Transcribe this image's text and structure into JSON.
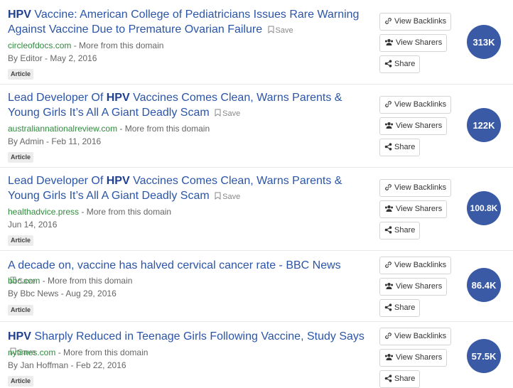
{
  "common": {
    "save_label": "Save",
    "more_label": "More from this domain",
    "separator": " - ",
    "view_backlinks": "View Backlinks",
    "view_sharers": "View Sharers",
    "share": "Share",
    "tag": "Article",
    "icons": [
      "bookmark-icon",
      "link-icon",
      "users-icon",
      "share-icon"
    ],
    "colors": {
      "title": "#2b55a8",
      "domain": "#2e8b3d",
      "circle": "#3a5aa6"
    }
  },
  "articles": [
    {
      "title_bold": "HPV",
      "title_rest": " Vaccine: American College of Pediatricians Issues Rare Warning Against Vaccine Due to Premature Ovarian Failure",
      "domain": "circleofdocs.com",
      "byline": "By Editor - May 2, 2016",
      "shares": "313K"
    },
    {
      "title_pre": "Lead Developer Of ",
      "title_bold": "HPV",
      "title_rest": " Vaccines Comes Clean, Warns Parents & Young Girls It’s All A Giant Deadly Scam",
      "domain": "australiannationalreview.com",
      "byline": "By Admin - Feb 11, 2016",
      "shares": "122K"
    },
    {
      "title_pre": "Lead Developer Of ",
      "title_bold": "HPV",
      "title_rest": " Vaccines Comes Clean, Warns Parents & Young Girls It’s All A Giant Deadly Scam",
      "domain": "healthadvice.press",
      "byline": "Jun 14, 2016",
      "shares": "100.8K"
    },
    {
      "title_rest": "A decade on, vaccine has halved cervical cancer rate - BBC News",
      "domain": "bbc.com",
      "byline": "By Bbc News - Aug 29, 2016",
      "shares": "86.4K"
    },
    {
      "title_bold": "HPV",
      "title_rest": " Sharply Reduced in Teenage Girls Following Vaccine, Study Says",
      "domain": "nytimes.com",
      "byline": "By Jan Hoffman - Feb 22, 2016",
      "shares": "57.5K"
    }
  ]
}
